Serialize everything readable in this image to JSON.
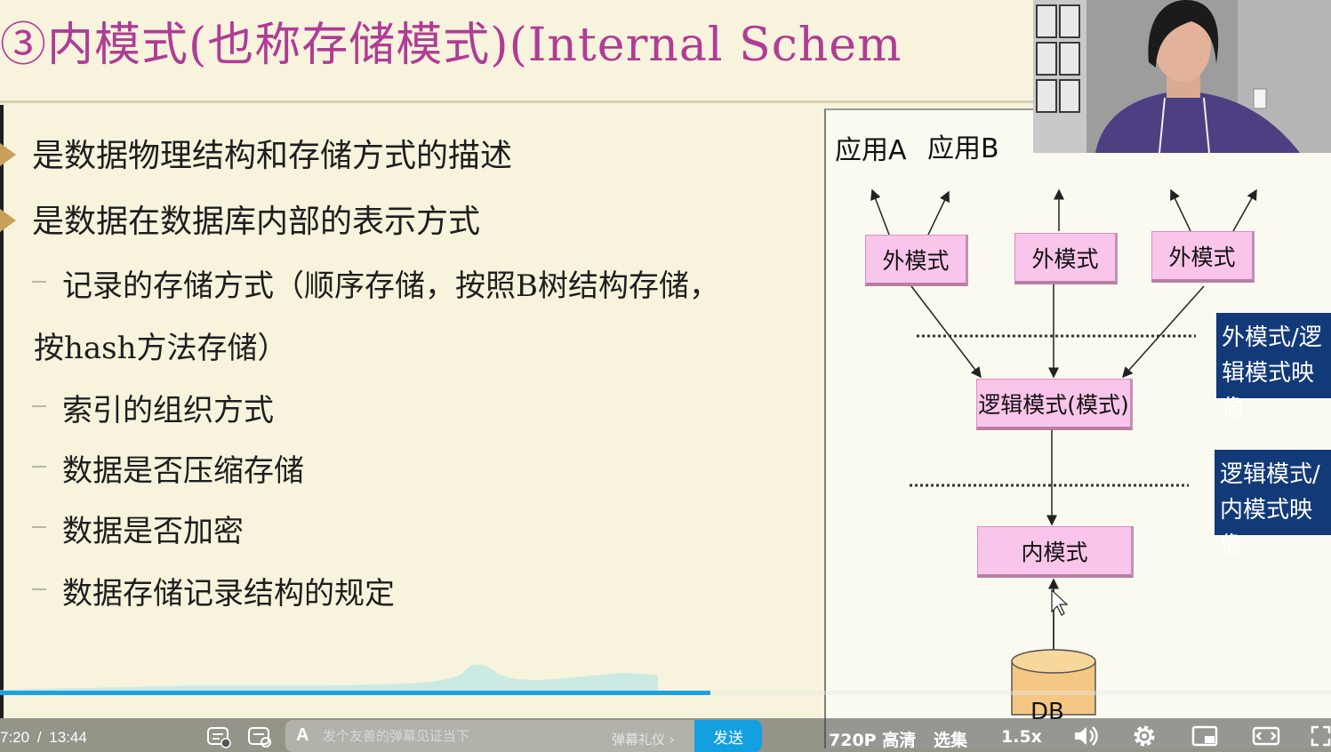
{
  "slide": {
    "title": "③内模式(也称存储模式)(Internal Schem",
    "bullets": [
      "是数据物理结构和存储方式的描述",
      "是数据在数据库内部的表示方式"
    ],
    "sub_items": [
      "记录的存储方式（顺序存储，按照B树结构存储，",
      "按hash方法存储）",
      "索引的组织方式",
      "数据是否压缩存储",
      "数据是否加密",
      "数据存储记录结构的规定"
    ]
  },
  "diagram": {
    "app_labels": [
      "应用A",
      "应用B"
    ],
    "external_boxes": [
      "外模式",
      "外模式",
      "外模式"
    ],
    "logical_box": "逻辑模式(模式)",
    "internal_box": "内模式",
    "db_label": "DB",
    "mapping_labels": [
      [
        "外模式/逻",
        "辑模式映像"
      ],
      [
        "逻辑模式/",
        "内模式映像"
      ]
    ]
  },
  "player": {
    "time_current": "7:20",
    "time_separator": "/",
    "time_total": "13:44",
    "progress": 0.534,
    "danmu_placeholder": "发个友善的弹幕见证当下",
    "danmu_etiquette": "弹幕礼仪",
    "send_label": "发送",
    "quality": "720P 高清",
    "episodes": "选集",
    "speed": "1.5x"
  }
}
